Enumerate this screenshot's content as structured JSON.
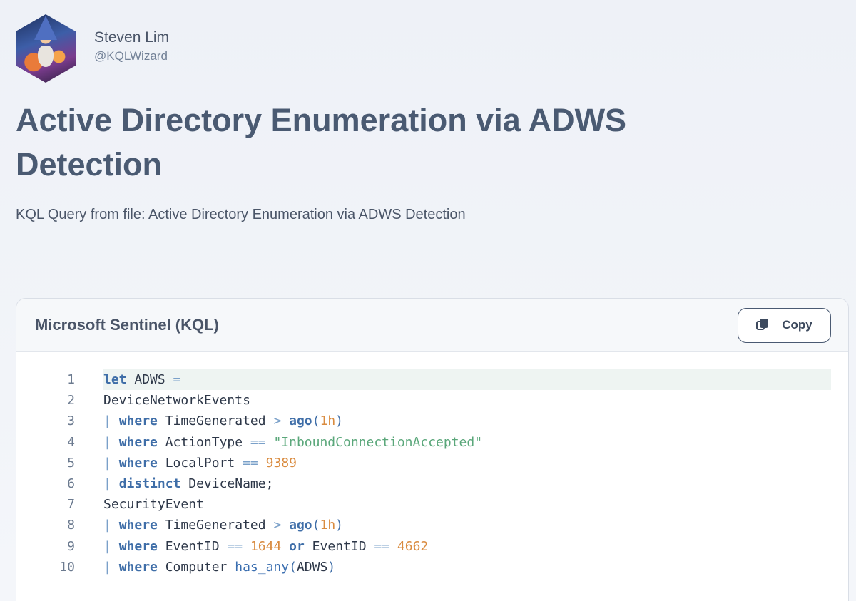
{
  "author": {
    "name": "Steven Lim",
    "handle": "@KQLWizard"
  },
  "page": {
    "title": "Active Directory Enumeration via ADWS Detection",
    "subtitle": "KQL Query from file: Active Directory Enumeration via ADWS Detection"
  },
  "code_card": {
    "title": "Microsoft Sentinel (KQL)",
    "copy_label": "Copy",
    "lines": [
      {
        "n": "1",
        "parts": [
          {
            "t": "let",
            "c": "kw"
          },
          {
            "t": " ADWS "
          },
          {
            "t": "=",
            "c": "op"
          }
        ]
      },
      {
        "n": "2",
        "parts": [
          {
            "t": "DeviceNetworkEvents"
          }
        ]
      },
      {
        "n": "3",
        "parts": [
          {
            "t": "|",
            "c": "pipe"
          },
          {
            "t": " "
          },
          {
            "t": "where",
            "c": "kw"
          },
          {
            "t": " TimeGenerated "
          },
          {
            "t": ">",
            "c": "op"
          },
          {
            "t": " "
          },
          {
            "t": "ago",
            "c": "kw"
          },
          {
            "t": "(",
            "c": "paren"
          },
          {
            "t": "1h",
            "c": "num"
          },
          {
            "t": ")",
            "c": "paren"
          }
        ]
      },
      {
        "n": "4",
        "parts": [
          {
            "t": "|",
            "c": "pipe"
          },
          {
            "t": " "
          },
          {
            "t": "where",
            "c": "kw"
          },
          {
            "t": " ActionType "
          },
          {
            "t": "==",
            "c": "op"
          },
          {
            "t": " "
          },
          {
            "t": "\"InboundConnectionAccepted\"",
            "c": "str"
          }
        ]
      },
      {
        "n": "5",
        "parts": [
          {
            "t": "|",
            "c": "pipe"
          },
          {
            "t": " "
          },
          {
            "t": "where",
            "c": "kw"
          },
          {
            "t": " LocalPort "
          },
          {
            "t": "==",
            "c": "op"
          },
          {
            "t": " "
          },
          {
            "t": "9389",
            "c": "num"
          }
        ]
      },
      {
        "n": "6",
        "parts": [
          {
            "t": "|",
            "c": "pipe"
          },
          {
            "t": " "
          },
          {
            "t": "distinct",
            "c": "kw"
          },
          {
            "t": " DeviceName;"
          }
        ]
      },
      {
        "n": "7",
        "parts": [
          {
            "t": "SecurityEvent"
          }
        ]
      },
      {
        "n": "8",
        "parts": [
          {
            "t": "|",
            "c": "pipe"
          },
          {
            "t": " "
          },
          {
            "t": "where",
            "c": "kw"
          },
          {
            "t": " TimeGenerated "
          },
          {
            "t": ">",
            "c": "op"
          },
          {
            "t": " "
          },
          {
            "t": "ago",
            "c": "kw"
          },
          {
            "t": "(",
            "c": "paren"
          },
          {
            "t": "1h",
            "c": "num"
          },
          {
            "t": ")",
            "c": "paren"
          }
        ]
      },
      {
        "n": "9",
        "parts": [
          {
            "t": "|",
            "c": "pipe"
          },
          {
            "t": " "
          },
          {
            "t": "where",
            "c": "kw"
          },
          {
            "t": " EventID "
          },
          {
            "t": "==",
            "c": "op"
          },
          {
            "t": " "
          },
          {
            "t": "1644",
            "c": "num"
          },
          {
            "t": " "
          },
          {
            "t": "or",
            "c": "kw"
          },
          {
            "t": " EventID "
          },
          {
            "t": "==",
            "c": "op"
          },
          {
            "t": " "
          },
          {
            "t": "4662",
            "c": "num"
          }
        ]
      },
      {
        "n": "10",
        "parts": [
          {
            "t": "|",
            "c": "pipe"
          },
          {
            "t": " "
          },
          {
            "t": "where",
            "c": "kw"
          },
          {
            "t": " Computer "
          },
          {
            "t": "has_any",
            "c": "fn"
          },
          {
            "t": "(",
            "c": "paren"
          },
          {
            "t": "ADWS"
          },
          {
            "t": ")",
            "c": "paren"
          }
        ]
      }
    ]
  }
}
